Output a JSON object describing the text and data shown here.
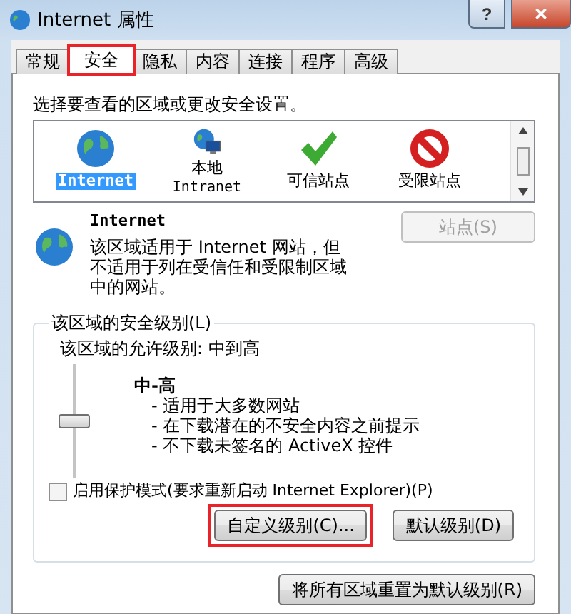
{
  "window": {
    "title": "Internet 属性",
    "help": "?",
    "close": "✕"
  },
  "tabs": [
    {
      "label": "常规",
      "selected": false,
      "highlighted": false
    },
    {
      "label": "安全",
      "selected": true,
      "highlighted": true
    },
    {
      "label": "隐私",
      "selected": false,
      "highlighted": false
    },
    {
      "label": "内容",
      "selected": false,
      "highlighted": false
    },
    {
      "label": "连接",
      "selected": false,
      "highlighted": false
    },
    {
      "label": "程序",
      "selected": false,
      "highlighted": false
    },
    {
      "label": "高级",
      "selected": false,
      "highlighted": false
    }
  ],
  "instruction": "选择要查看的区域或更改安全设置。",
  "zones": [
    {
      "kind": "globe",
      "label": "Internet",
      "selected": true
    },
    {
      "kind": "intranet",
      "label": "本地",
      "sublabel": "Intranet",
      "selected": false
    },
    {
      "kind": "check",
      "label": "可信站点",
      "selected": false
    },
    {
      "kind": "blocked",
      "label": "受限站点",
      "selected": false
    }
  ],
  "zone_info": {
    "title": "Internet",
    "description": "该区域适用于 Internet 网站，但不适用于列在受信任和受限制区域中的网站。",
    "sites_button": {
      "label": "站点(S)",
      "disabled": true
    }
  },
  "security_level": {
    "legend": "该区域的安全级别(L)",
    "allowed": "该区域的允许级别: 中到高",
    "level_name": "中-高",
    "level": 0.5,
    "bullets": [
      "- 适用于大多数网站",
      "- 在下载潜在的不安全内容之前提示",
      "- 不下载未签名的 ActiveX 控件"
    ],
    "protected_mode": {
      "label": "启用保护模式(要求重新启动 Internet Explorer)(P)",
      "checked": false
    },
    "buttons": [
      {
        "label": "自定义级别(C)...",
        "highlighted": true
      },
      {
        "label": "默认级别(D)",
        "highlighted": false
      }
    ]
  },
  "reset_button": {
    "label": "将所有区域重置为默认级别(R)"
  }
}
